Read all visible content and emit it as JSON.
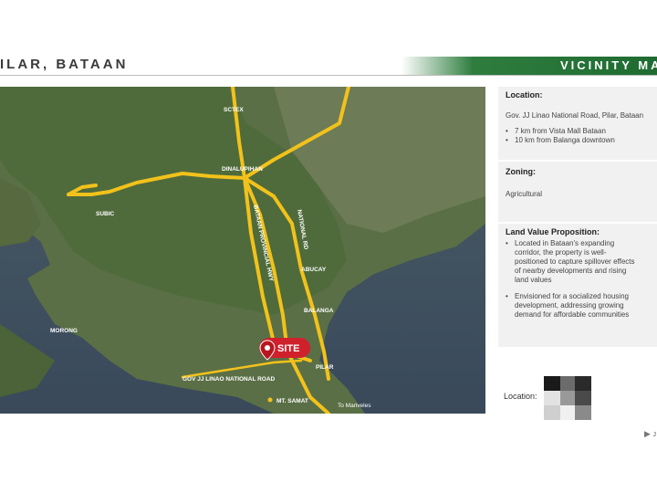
{
  "header": {
    "title": "ILAR, BATAAN",
    "right_title": "VICINITY MA"
  },
  "map": {
    "labels": {
      "sctex": "SCTEX",
      "dinalupihan": "DINALUPIHAN",
      "subic": "SUBIC",
      "morong": "MORONG",
      "national_rd": "NATIONAL RD",
      "bataan_provincial_hwy": "BATAAN PROVINCIAL HWY",
      "abucay": "ABUCAY",
      "balanga": "BALANGA",
      "pilar": "PILAR",
      "gov_rd": "GOV JJ LINAO NATIONAL ROAD",
      "mt_samat": "MT. SAMAT",
      "to_mariveles": "To Mariveles",
      "site": "SITE"
    }
  },
  "info": {
    "location_title": "Location:",
    "location_text": "Gov. JJ Linao National Road, Pilar, Bataan",
    "location_bullets": [
      "7 km from Vista Mall Bataan",
      "10 km from Balanga downtown"
    ],
    "zoning_title": "Zoning:",
    "zoning_text": "Agricultural",
    "lvp_title": "Land Value Proposition:",
    "lvp_bullets": [
      [
        "Located in Bataan's expanding",
        "corridor, the property is well-",
        "positioned to capture spillover effects",
        "of nearby developments and rising",
        "land values"
      ],
      [
        "Envisioned for a socialized housing",
        "development, addressing growing",
        "demand for affordable communities"
      ]
    ]
  },
  "qr_label": "Location:",
  "nav_arrow": "▶ ᴊ"
}
